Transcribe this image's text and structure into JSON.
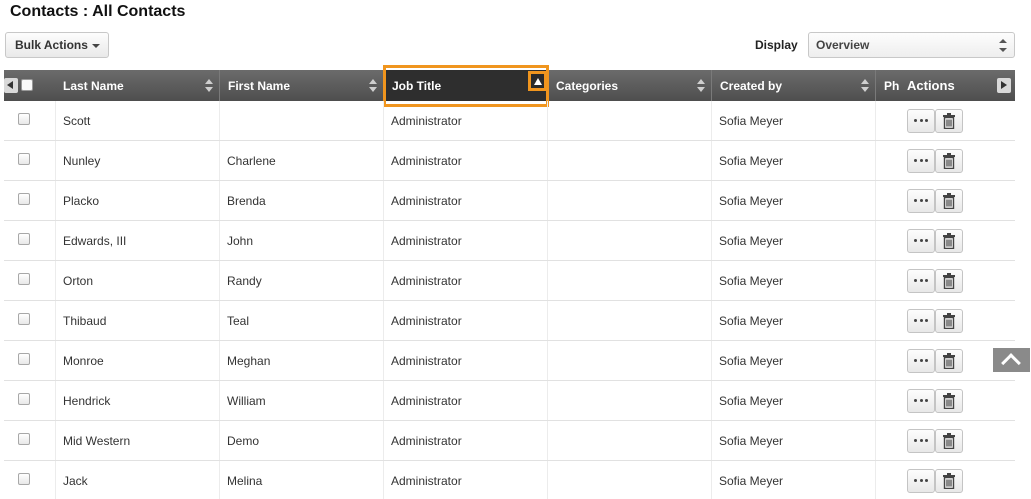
{
  "page": {
    "title": "Contacts : All Contacts"
  },
  "toolbar": {
    "bulk_actions_label": "Bulk Actions",
    "display_label": "Display",
    "display_value": "Overview"
  },
  "table": {
    "columns": {
      "last_name": "Last Name",
      "first_name": "First Name",
      "job_title": "Job Title",
      "categories": "Categories",
      "created_by": "Created by",
      "phone": "Ph",
      "actions": "Actions"
    },
    "sort": {
      "column": "Job Title",
      "direction": "ascending"
    },
    "rows": [
      {
        "last_name": "Scott",
        "first_name": "",
        "job_title": "Administrator",
        "categories": "",
        "created_by": "Sofia Meyer"
      },
      {
        "last_name": "Nunley",
        "first_name": "Charlene",
        "job_title": "Administrator",
        "categories": "",
        "created_by": "Sofia Meyer"
      },
      {
        "last_name": "Placko",
        "first_name": "Brenda",
        "job_title": "Administrator",
        "categories": "",
        "created_by": "Sofia Meyer"
      },
      {
        "last_name": "Edwards, III",
        "first_name": "John",
        "job_title": "Administrator",
        "categories": "",
        "created_by": "Sofia Meyer"
      },
      {
        "last_name": "Orton",
        "first_name": "Randy",
        "job_title": "Administrator",
        "categories": "",
        "created_by": "Sofia Meyer"
      },
      {
        "last_name": "Thibaud",
        "first_name": "Teal",
        "job_title": "Administrator",
        "categories": "",
        "created_by": "Sofia Meyer"
      },
      {
        "last_name": "Monroe",
        "first_name": "Meghan",
        "job_title": "Administrator",
        "categories": "",
        "created_by": "Sofia Meyer"
      },
      {
        "last_name": "Hendrick",
        "first_name": "William",
        "job_title": "Administrator",
        "categories": "",
        "created_by": "Sofia Meyer"
      },
      {
        "last_name": "Mid Western",
        "first_name": "Demo",
        "job_title": "Administrator",
        "categories": "",
        "created_by": "Sofia Meyer"
      },
      {
        "last_name": "Jack",
        "first_name": "Melina",
        "job_title": "Administrator",
        "categories": "",
        "created_by": "Sofia Meyer"
      }
    ]
  },
  "icons": {
    "more": "ellipsis-icon",
    "delete": "trash-icon",
    "scroll_top": "chevron-up-icon"
  },
  "colors": {
    "highlight": "#f0951e",
    "header_bg": "#5a5a5a"
  }
}
